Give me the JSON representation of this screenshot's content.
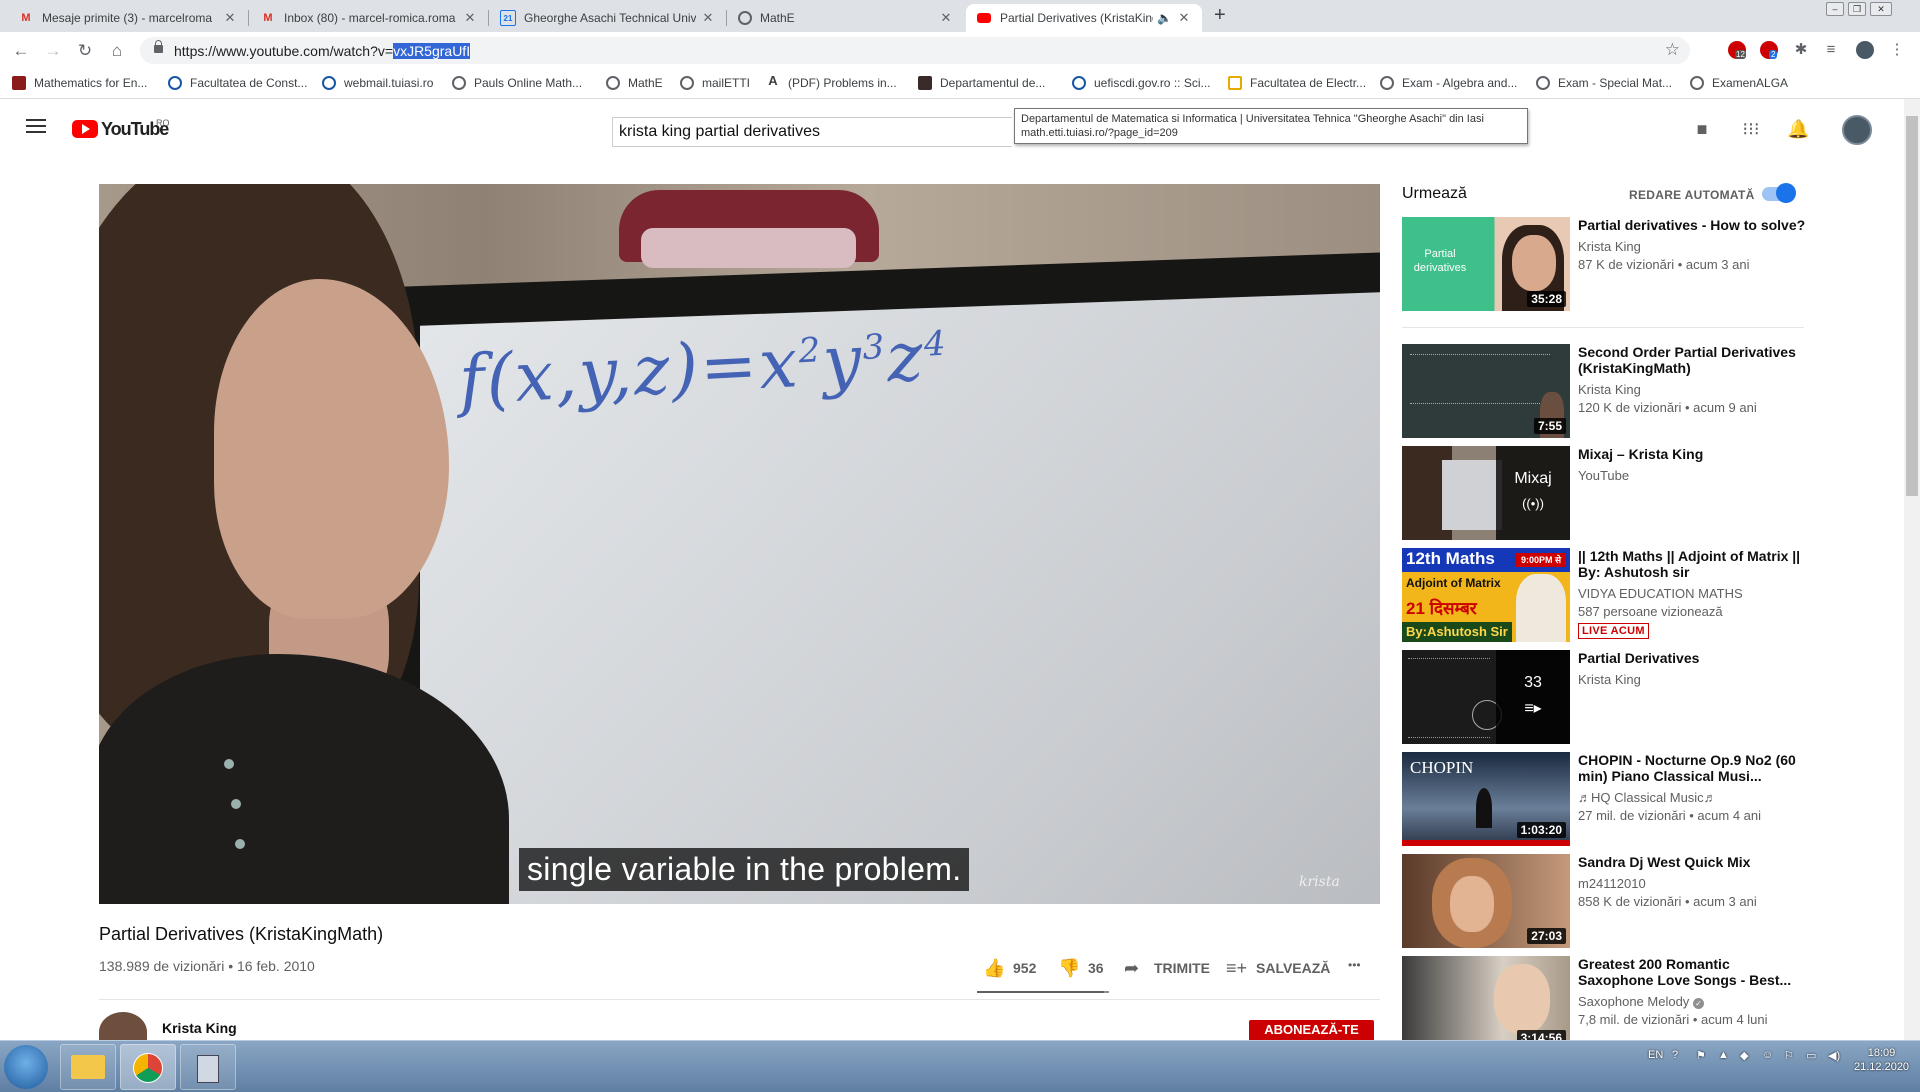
{
  "browser": {
    "tabs": [
      {
        "label": "Mesaje primite (3) - marcelroma",
        "icon": "gmail-icon"
      },
      {
        "label": "Inbox (80) - marcel-romica.roma",
        "icon": "gmail-icon"
      },
      {
        "label": "Gheorghe Asachi Technical Unive",
        "icon": "calendar-icon"
      },
      {
        "label": "MathE",
        "icon": "globe-icon"
      },
      {
        "label": "Partial Derivatives (KristaKing",
        "icon": "youtube-icon"
      }
    ],
    "new_tab": "+",
    "url_prefix": "https://www.youtube.com/watch?v=",
    "url_selected": "vxJR5graUfI",
    "ext_badges": [
      "12",
      "2"
    ],
    "bookmarks": [
      "Mathematics for En...",
      "Facultatea de Const...",
      "webmail.tuiasi.ro",
      "Pauls Online Math...",
      "MathE",
      "mailETTI",
      "(PDF) Problems in...",
      "Departamentul de...",
      "uefiscdi.gov.ro :: Sci...",
      "Facultatea de Electr...",
      "Exam - Algebra and...",
      "Exam - Special Mat...",
      "ExamenALGA"
    ],
    "tooltip_line1": "Departamentul de Matematica si Informatica | Universitatea Tehnica \"Gheorghe Asachi\" din Iasi",
    "tooltip_line2": "math.etti.tuiasi.ro/?page_id=209"
  },
  "youtube": {
    "logo_text": "YouTube",
    "region": "RO",
    "search_value": "krista king partial derivatives",
    "video": {
      "equation": "f(x,y,z)=x²y³z⁴",
      "caption": "single variable in the problem.",
      "watermark": "krista",
      "title": "Partial Derivatives (KristaKingMath)",
      "views": "138.989 de vizionări",
      "date": "16 feb. 2010",
      "likes": "952",
      "dislikes": "36",
      "share": "TRIMITE",
      "save": "SALVEAZĂ",
      "more": "•••",
      "like_ratio": 0.96
    },
    "channel": {
      "name": "Krista King",
      "subscribe": "ABONEAZĂ-TE"
    },
    "sidebar": {
      "up_next": "Urmează",
      "autoplay": "REDARE AUTOMATĂ",
      "autoplay_on": true,
      "items": [
        {
          "title": "Partial derivatives - How to solve?",
          "channel": "Krista King",
          "views": "87 K de vizionări • acum 3 ani",
          "duration": "35:28",
          "thumb_text": "Partial derivatives"
        },
        {
          "title": "Second Order Partial Derivatives (KristaKingMath)",
          "channel": "Krista King",
          "views": "120 K de vizionări • acum 9 ani",
          "duration": "7:55"
        },
        {
          "title": "Mixaj – Krista King",
          "channel": "YouTube",
          "overlay": "Mixaj"
        },
        {
          "title": "|| 12th Maths || Adjoint of Matrix || By: Ashutosh sir",
          "channel": "VIDYA EDUCATION MATHS",
          "views": "587 persoane vizionează",
          "badge": "LIVE ACUM",
          "thumb_l1": "12th Maths",
          "thumb_time": "9:00PM से",
          "thumb_l2": "Adjoint of Matrix",
          "thumb_l3": "21 दिसम्बर",
          "thumb_l4": "By:Ashutosh Sir"
        },
        {
          "title": "Partial Derivatives",
          "channel": "Krista King",
          "overlay": "33"
        },
        {
          "title": "CHOPIN - Nocturne Op.9 No2 (60 min) Piano Classical Musi...",
          "channel": "♬HQ Classical Music♬",
          "views": "27 mil. de vizionări • acum 4 ani",
          "duration": "1:03:20",
          "thumb_text": "CHOPIN"
        },
        {
          "title": "Sandra Dj West Quick Mix",
          "channel": "m24112010",
          "views": "858 K de vizionări • acum 3 ani",
          "duration": "27:03"
        },
        {
          "title": "Greatest 200 Romantic Saxophone Love Songs - Best...",
          "channel": "Saxophone Melody",
          "views": "7,8 mil. de vizionări • acum 4 luni",
          "duration": "3:14:56"
        }
      ]
    }
  },
  "taskbar": {
    "lang": "EN",
    "time": "18:09",
    "date": "21.12.2020"
  },
  "colors": {
    "accent_red": "#ff0000",
    "subscribe_red": "#cc0000",
    "toggle_blue": "#1a73e8",
    "selection_blue": "#3367d6"
  }
}
